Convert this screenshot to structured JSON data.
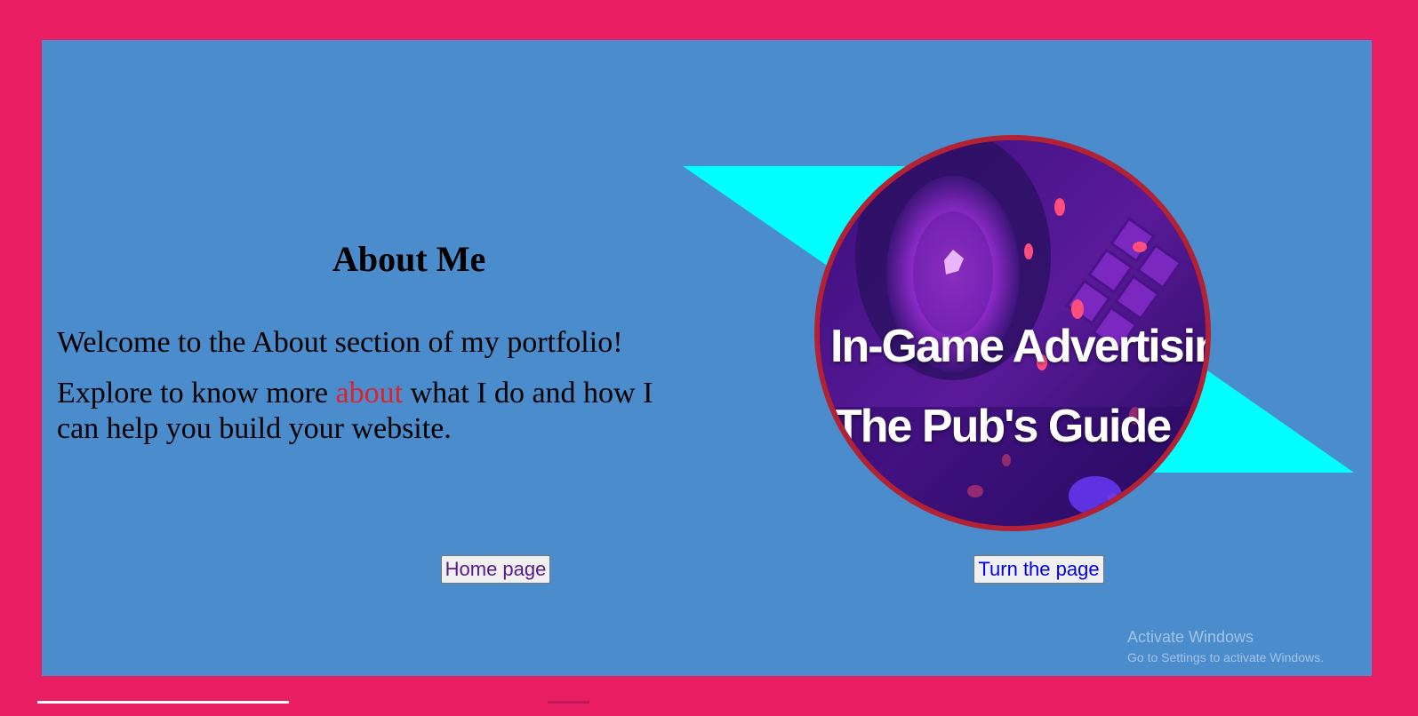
{
  "colors": {
    "page_bg": "#e91e63",
    "panel_bg": "#4a8ccc",
    "accent_cyan": "#00ffff",
    "circle_border": "#b32135",
    "link_red": "#e0202a"
  },
  "about": {
    "title": "About Me",
    "intro": "Welcome to the About section of my portfolio!",
    "explore_before": "Explore to know more ",
    "explore_highlight": "about",
    "explore_after": " what I do and how I can help you build your website."
  },
  "image": {
    "line1": "In-Game Advertising:",
    "line2": "The Pub's Guide"
  },
  "buttons": {
    "home": "Home page",
    "next": "Turn the page"
  },
  "watermark": {
    "title": "Activate Windows",
    "subtitle": "Go to Settings to activate Windows."
  }
}
